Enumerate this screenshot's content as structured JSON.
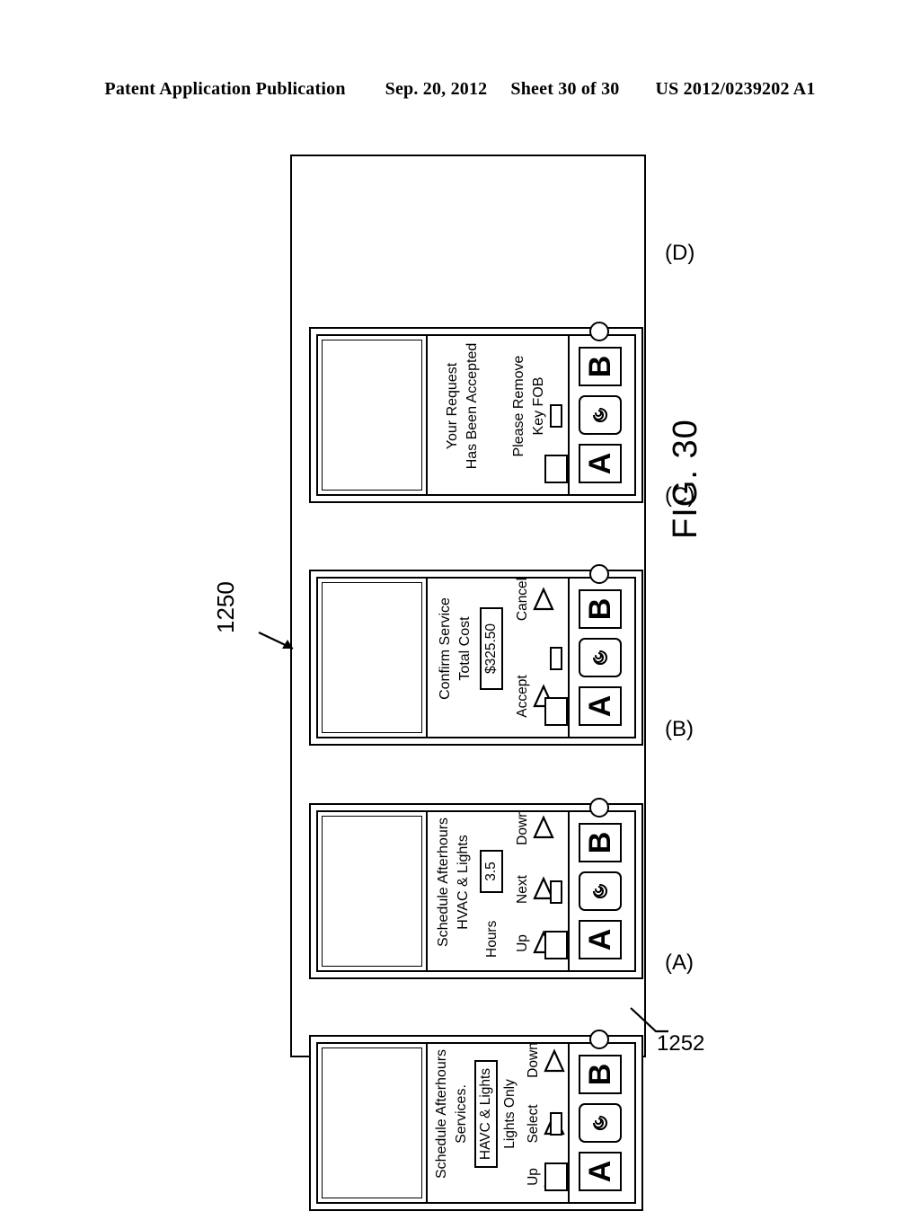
{
  "header": {
    "left": "Patent Application Publication",
    "date": "Sep. 20, 2012",
    "sheet": "Sheet 30 of 30",
    "number": "US 2012/0239202 A1"
  },
  "figure": {
    "caption": "FIG. 30",
    "ref_assembly": "1250",
    "ref_button": "1252"
  },
  "panels": [
    {
      "id": "A",
      "label": "(A)",
      "screen": {
        "title_line1": "Schedule Afterhours",
        "title_line2": "Services.",
        "selected_value": "HAVC & Lights",
        "option_line": "Lights Only",
        "softkey_left": "Up",
        "softkey_mid": "Select",
        "softkey_right": "Down"
      },
      "keys": {
        "a": "A",
        "b": "B",
        "center_icon": "spiral-icon",
        "round": "round-key"
      }
    },
    {
      "id": "B",
      "label": "(B)",
      "screen": {
        "title_line1": "Schedule Afterhours",
        "title_line2": "HVAC & Lights",
        "field_label": "Hours",
        "field_value": "3.5",
        "softkey_left": "Up",
        "softkey_mid": "Next",
        "softkey_right": "Down"
      },
      "keys": {
        "a": "A",
        "b": "B",
        "center_icon": "spiral-icon",
        "round": "round-key"
      }
    },
    {
      "id": "C",
      "label": "(C)",
      "screen": {
        "title_line1": "Confirm Service",
        "title_line2": "Total Cost",
        "field_value": "$325.50",
        "softkey_left": "Accept",
        "softkey_right": "Cancel"
      },
      "keys": {
        "a": "A",
        "b": "B",
        "center_icon": "spiral-icon",
        "round": "round-key"
      }
    },
    {
      "id": "D",
      "label": "(D)",
      "screen": {
        "title_line1": "Your Request",
        "title_line2": "Has Been Accepted",
        "message_line1": "Please Remove",
        "message_line2": "Key FOB"
      },
      "keys": {
        "a": "A",
        "b": "B",
        "center_icon": "spiral-icon",
        "round": "round-key"
      }
    }
  ]
}
